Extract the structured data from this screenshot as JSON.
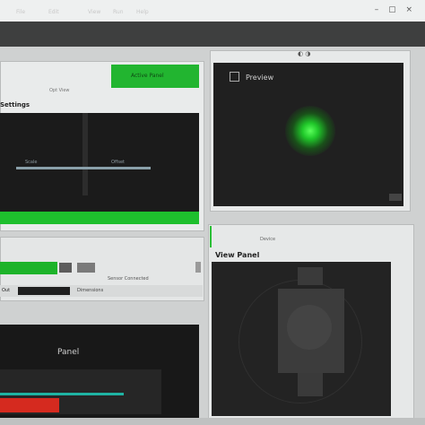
{
  "window": {
    "controls": "– ▢ ×"
  },
  "menu": {
    "items": [
      "File",
      "Edit",
      "View",
      "Run",
      "Help"
    ]
  },
  "top_left_panel": {
    "header_green_label": "Active Panel",
    "sub": "Opt View",
    "title": "Settings",
    "viewer_label_left": "Scale",
    "viewer_label_right": "Offset"
  },
  "middle_left_panel": {
    "label": "Sensor Connected",
    "row_prefix": "Out",
    "row_text": "Dimensions"
  },
  "bottom_left_panel": {
    "title": "Panel"
  },
  "top_right_panel": {
    "header_icons": "◐ ◑",
    "label": "Preview"
  },
  "bottom_right_panel": {
    "top_label": "Device",
    "title": "View Panel"
  },
  "colors": {
    "accent_green": "#22b530",
    "dark_bg": "#1b1b1b",
    "menubar": "#3e3f3f",
    "red": "#d52a1f",
    "cyan": "#1fb3a3"
  }
}
